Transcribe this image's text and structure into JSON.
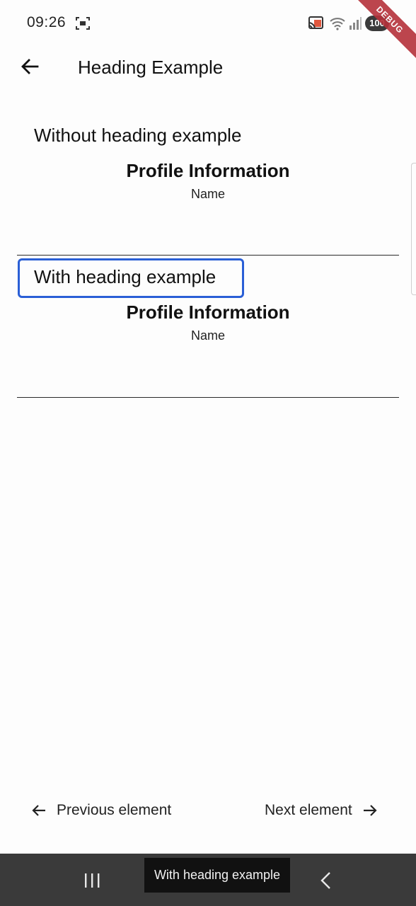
{
  "status_bar": {
    "time": "09:26",
    "battery": "100",
    "debug_label": "DEBUG"
  },
  "app_bar": {
    "title": "Heading Example",
    "back_icon": "arrow-left-icon"
  },
  "sections": [
    {
      "heading": "Without heading example",
      "profile_title": "Profile Information",
      "name_label": "Name",
      "name_value": ""
    },
    {
      "heading": "With heading example",
      "profile_title": "Profile Information",
      "name_label": "Name",
      "name_value": ""
    }
  ],
  "navigation": {
    "previous_label": "Previous element",
    "next_label": "Next element"
  },
  "toast": {
    "text": "With heading example"
  },
  "colors": {
    "focus_outline": "#2a5fd6",
    "system_bar": "#3a3a3a",
    "debug_banner": "#b5323a"
  }
}
